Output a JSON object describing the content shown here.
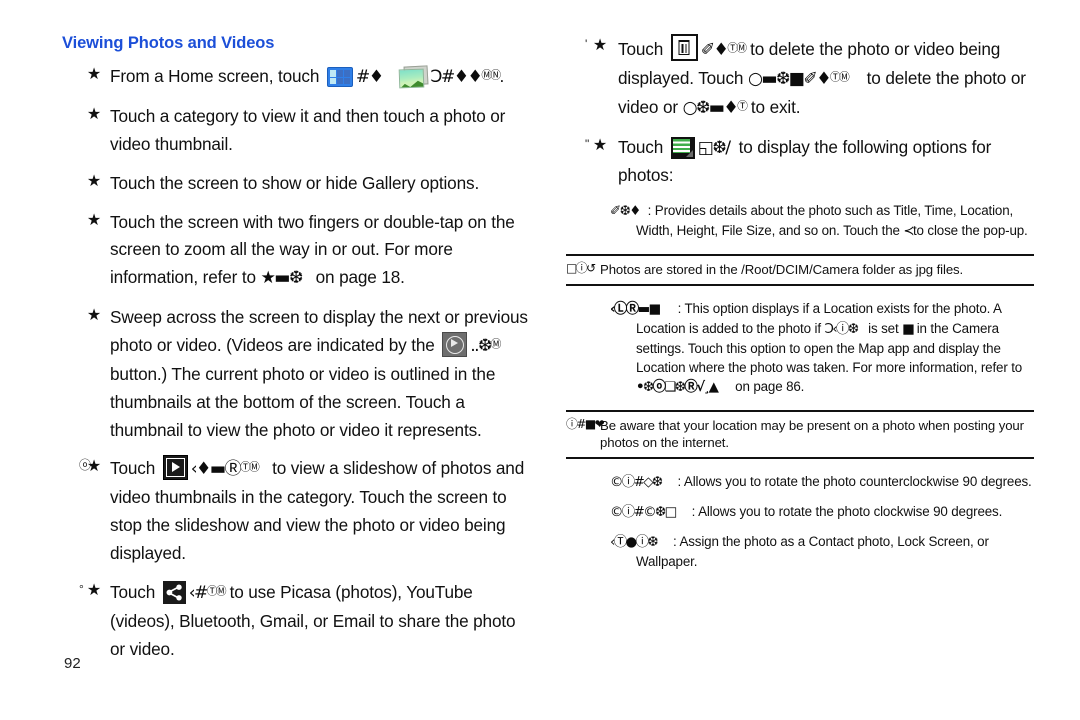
{
  "page": {
    "folio": "92",
    "section_title": "Viewing Photos and Videos"
  },
  "left_column": {
    "bullets": [
      {
        "marker": "star",
        "prefix": "",
        "parts": [
          {
            "type": "text",
            "value": "From a Home screen, touch "
          },
          {
            "type": "icon",
            "icon": "apps-grid-icon"
          },
          {
            "type": "garbled",
            "value": "#♦",
            "size": "normal"
          },
          {
            "type": "text",
            "value": "   "
          },
          {
            "type": "icon",
            "icon": "gallery-icon"
          },
          {
            "type": "garbled",
            "value": "Ɔ#♦♦",
            "size": "normal",
            "sup": "ⓂⓃ"
          },
          {
            "type": "text",
            "value": "."
          }
        ]
      },
      {
        "marker": "star",
        "prefix": "",
        "parts": [
          {
            "type": "text",
            "value": "Touch a category to view it and then touch a photo or video thumbnail."
          }
        ]
      },
      {
        "marker": "star",
        "prefix": "",
        "parts": [
          {
            "type": "text",
            "value": "Touch the screen to show or hide Gallery options."
          }
        ]
      },
      {
        "marker": "star",
        "prefix": "",
        "parts": [
          {
            "type": "text",
            "value": "Touch the screen with two fingers or double-tap on the screen to zoom all the way in or out. For more information, refer to "
          },
          {
            "type": "garbled",
            "value": "★▬❆",
            "size": "normal"
          },
          {
            "type": "text",
            "value": "   on page 18."
          }
        ]
      },
      {
        "marker": "star",
        "prefix": "",
        "parts": [
          {
            "type": "text",
            "value": "Sweep across the screen to display the next or previous photo or video. (Videos are indicated by the "
          },
          {
            "type": "icon",
            "icon": "play-button-icon"
          },
          {
            "type": "garbled",
            "value": "..❆",
            "size": "normal",
            "sup": "Ⓜ"
          },
          {
            "type": "text",
            "value": " button.) The current photo or video is outlined in the thumbnails at the bottom of the screen. Touch a thumbnail to view the photo or video it represents."
          }
        ]
      },
      {
        "marker": "star",
        "prefix": "ⓞ",
        "parts": [
          {
            "type": "text",
            "value": "Touch "
          },
          {
            "type": "icon",
            "icon": "slideshow-play-icon"
          },
          {
            "type": "garbled",
            "value": "‹♦▬Ⓡ",
            "size": "normal",
            "sup": "ⓉⓂ"
          },
          {
            "type": "text",
            "value": "   to view a slideshow of photos and video thumbnails in the category. Touch the screen to stop the slideshow and view the photo or video being displayed."
          }
        ]
      },
      {
        "marker": "star",
        "prefix": "°",
        "parts": [
          {
            "type": "text",
            "value": "Touch "
          },
          {
            "type": "icon",
            "icon": "share-icon"
          },
          {
            "type": "garbled",
            "value": "‹#",
            "size": "normal",
            "sup": "ⓉⓂ"
          },
          {
            "type": "text",
            "value": " to use Picasa (photos), YouTube (videos), Bluetooth, Gmail, or Email to share the photo or video."
          }
        ]
      }
    ]
  },
  "right_column": {
    "bullets": [
      {
        "marker": "star",
        "prefix": "'",
        "parts": [
          {
            "type": "text",
            "value": "Touch "
          },
          {
            "type": "icon",
            "icon": "delete-trash-icon"
          },
          {
            "type": "garbled",
            "value": "✐♦",
            "size": "normal",
            "sup": "ⓉⓂ"
          },
          {
            "type": "text",
            "value": " to delete the photo or video being displayed. Touch "
          },
          {
            "type": "garbled",
            "value": "○▬❆■✐♦",
            "size": "normal",
            "sup": "ⓉⓂ"
          },
          {
            "type": "text",
            "value": "    to delete the photo or video or "
          },
          {
            "type": "garbled",
            "value": "○❆▬♦",
            "size": "normal",
            "sup": "Ⓣ"
          },
          {
            "type": "text",
            "value": " to exit."
          }
        ]
      },
      {
        "marker": "star",
        "prefix": "\"",
        "parts": [
          {
            "type": "text",
            "value": "Touch "
          },
          {
            "type": "icon",
            "icon": "menu-options-icon"
          },
          {
            "type": "garbled",
            "value": "◱❆/",
            "size": "normal"
          },
          {
            "type": "text",
            "value": "  to display the following options for photos:"
          }
        ]
      }
    ],
    "options_top": [
      {
        "lead": "✐❆♦",
        "text": ": Provides details about the photo such as Title, Time, Location, Width, Height, File Size, and so on. Touch the ",
        "inline_glyph": "≺",
        "text_tail": "to close the pop-up."
      }
    ],
    "note_band": {
      "mark": "□ⓘ↺",
      "text": "Photos are stored in the /Root/DCIM/Camera folder as jpg files."
    },
    "location_option": {
      "lead": "‹ⓁⓇ▬■",
      "text_1": ": This option displays if a Location exists for the photo. A Location is added to the photo if ",
      "glyph_1": "Ɔ‹ⓘ❆",
      "text_2": "   is set ",
      "glyph_2": "■",
      "text_3": " in the Camera settings. Touch this option to open the Map app and display the Location where the photo was taken. For more information, refer to ",
      "glyph_3": "•❆ⓞ❑❆Ⓡ√¸▲",
      "text_4": "     on page 86."
    },
    "warning_band": {
      "mark": "ⓘ#■❤",
      "text": "Be aware that your location may be present on a photo when posting your photos on the internet."
    },
    "options_bottom": [
      {
        "lead": "©ⓘ#◇❆",
        "text": ": Allows you to rotate the photo counterclockwise 90 degrees."
      },
      {
        "lead": "©ⓘ#©❆□",
        "text": ": Allows you to rotate the photo clockwise 90 degrees."
      },
      {
        "lead": "‹Ⓣ●ⓘ❆",
        "text": ": Assign the photo as a Contact photo, Lock Screen, or Wallpaper."
      }
    ]
  }
}
